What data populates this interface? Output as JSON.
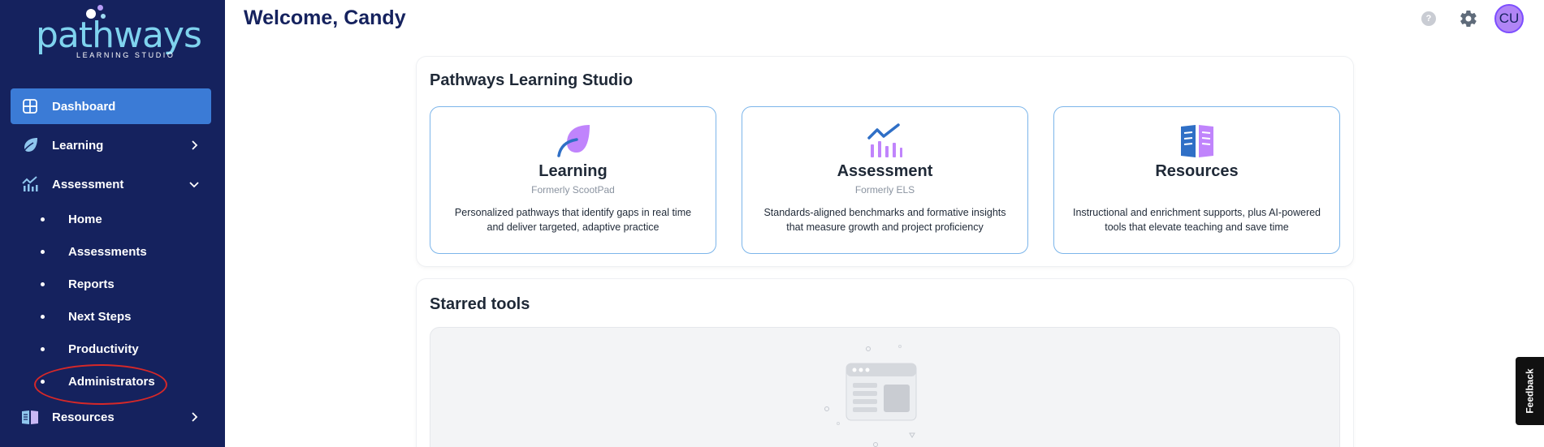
{
  "app": {
    "logo_word": "pathways",
    "logo_sub": "LEARNING STUDIO"
  },
  "header": {
    "welcome": "Welcome, Candy",
    "help_label": "?",
    "avatar_initials": "CU"
  },
  "sidebar": {
    "items": [
      {
        "label": "Dashboard",
        "icon": "dashboard-icon",
        "active": true
      },
      {
        "label": "Learning",
        "icon": "leaf-icon",
        "chevron": "right"
      },
      {
        "label": "Assessment",
        "icon": "chart-icon",
        "chevron": "down"
      },
      {
        "label": "Resources",
        "icon": "book-icon",
        "chevron": "right"
      }
    ],
    "assessment_sub": [
      {
        "label": "Home"
      },
      {
        "label": "Assessments"
      },
      {
        "label": "Reports"
      },
      {
        "label": "Next Steps"
      },
      {
        "label": "Productivity"
      },
      {
        "label": "Administrators"
      }
    ]
  },
  "studio": {
    "title": "Pathways Learning Studio",
    "cards": [
      {
        "title": "Learning",
        "subtitle": "Formerly ScootPad",
        "description": "Personalized pathways that identify gaps in real time and deliver targeted, adaptive practice",
        "icon": "leaf-icon"
      },
      {
        "title": "Assessment",
        "subtitle": "Formerly ELS",
        "description": "Standards-aligned benchmarks and formative insights that measure growth and project proficiency",
        "icon": "chart-icon"
      },
      {
        "title": "Resources",
        "subtitle": "",
        "description": "Instructional and enrichment supports, plus AI-powered tools that elevate teaching and save time",
        "icon": "book-icon"
      }
    ]
  },
  "starred": {
    "title": "Starred tools"
  },
  "feedback": {
    "label": "Feedback"
  },
  "colors": {
    "sidebar_bg": "#15225e",
    "active_item": "#3b7bd6",
    "card_border": "#7cb5ea",
    "highlight_ring": "#d62828",
    "accent_purple": "#c084fc",
    "accent_blue": "#2f6fc6"
  }
}
